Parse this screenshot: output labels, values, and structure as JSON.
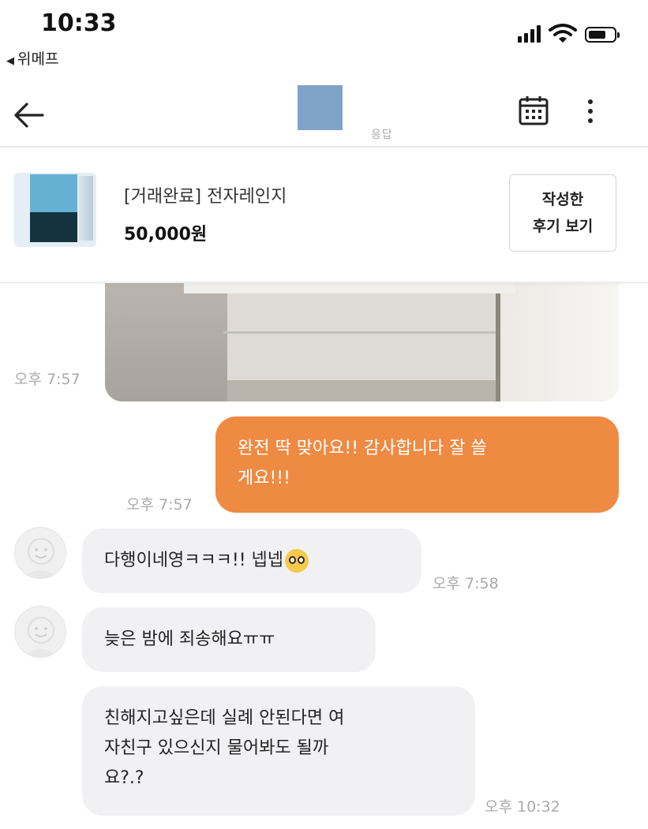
{
  "status_bar": {
    "time": "10:33",
    "back_app_label": "위메프",
    "signal_bars": 4,
    "battery_level": 0.7
  },
  "header": {
    "subtitle": "응답",
    "icons": [
      "back-arrow-icon",
      "calendar-icon",
      "more-vertical-icon"
    ]
  },
  "product": {
    "title": "[거래완료] 전자레인지",
    "price": "50,000원",
    "review_button": "작성한\n후기 보기"
  },
  "messages": [
    {
      "type": "photo",
      "sender": "other",
      "time": "오후 7:57"
    },
    {
      "type": "text",
      "sender": "me",
      "line1": "완전 딱 맞아요!! 감사합니다 잘 쓸",
      "line2": "게요!!!",
      "time": "오후 7:57"
    },
    {
      "type": "text",
      "sender": "other",
      "text": "다행이네영ㅋㅋㅋ!! 넵넵",
      "emoji": "pleading-face",
      "time": "오후 7:58"
    },
    {
      "type": "text",
      "sender": "other",
      "text": "늦은 밤에 죄송해요ㅠㅠ"
    },
    {
      "type": "text",
      "sender": "other",
      "line1": "친해지고싶은데 실례 안된다면 여",
      "line2": "자친구 있으신지 물어봐도 될까",
      "line3": "요?.?",
      "time": "오후 10:32"
    }
  ],
  "colors": {
    "my_bubble": "#ef8a43",
    "their_bubble": "#f1f1f3",
    "header_avatar": "#7fa2c9"
  }
}
